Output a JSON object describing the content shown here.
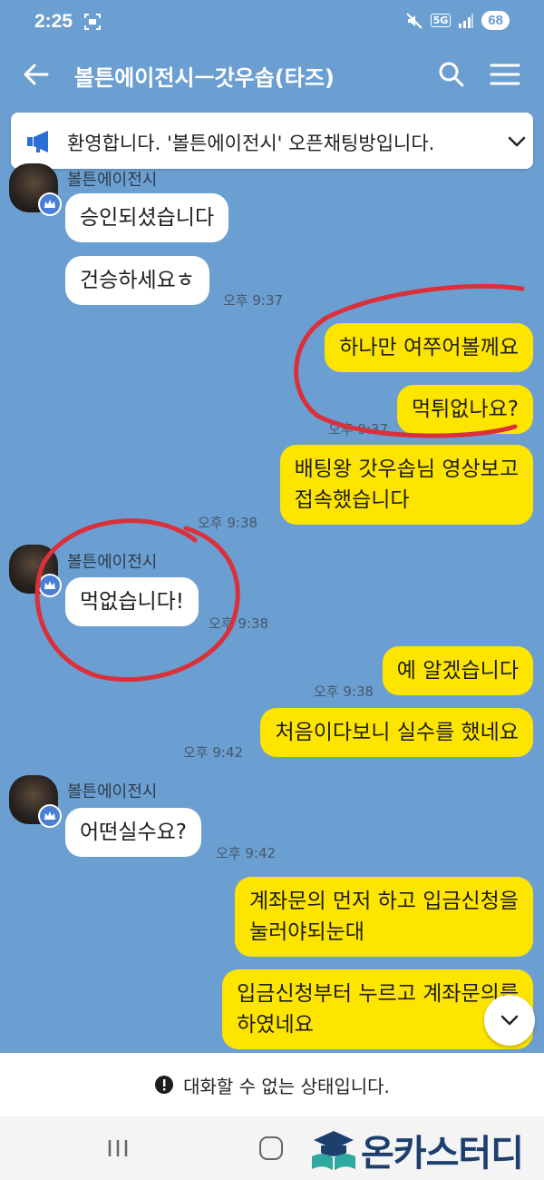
{
  "status_bar": {
    "time": "2:25",
    "network": "5G",
    "battery": "68",
    "icons": [
      "screenshot-icon",
      "mute-icon",
      "signal-icon"
    ]
  },
  "header": {
    "title": "볼튼에이전시ㅡ갓우솝(타즈)",
    "icons": [
      "back-arrow-icon",
      "search-icon",
      "hamburger-menu-icon"
    ]
  },
  "notice": {
    "text": "환영합니다. '볼튼에이전시' 오픈채팅방입니다.",
    "icons": [
      "megaphone-icon",
      "chevron-down-icon"
    ]
  },
  "messages": {
    "m1": {
      "sender": "볼튼에이전시",
      "text": "승인되셨습니다"
    },
    "m2": {
      "text": "건승하세요ㅎ",
      "time": "오후 9:37"
    },
    "m3": {
      "text": "하나만 여쭈어볼께요"
    },
    "m4": {
      "text": "먹튀없나요?",
      "time": "오후 9:37"
    },
    "m5": {
      "line1": "배팅왕 갓우솝님 영상보고",
      "line2": "접속했습니다",
      "time": "오후 9:38"
    },
    "m6": {
      "sender": "볼튼에이전시",
      "text": "먹없습니다!",
      "time": "오후 9:38"
    },
    "m7": {
      "text": "예 알겠습니다",
      "time": "오후 9:38"
    },
    "m8": {
      "text": "처음이다보니 실수를 했네요",
      "time": "오후 9:42"
    },
    "m9": {
      "sender": "볼튼에이전시",
      "text": "어떤실수요?",
      "time": "오후 9:42"
    },
    "m10": {
      "line1": "계좌문의 먼저 하고 입금신청을",
      "line2": "눌러야되눈대"
    },
    "m11": {
      "line1": "입금신청부터 누르고 계좌문의를",
      "line2": "하였네요"
    }
  },
  "footer": {
    "disabled_text": "대화할 수 없는 상태입니다.",
    "icon": "exclamation-circle-icon"
  },
  "watermark": {
    "text": "온카스터디"
  },
  "colors": {
    "chat_background": "#6c9fd1",
    "outgoing_bubble": "#fee500",
    "incoming_bubble": "#ffffff",
    "annotation_circle": "#d9303a",
    "admin_badge": "#4a7fd6"
  }
}
